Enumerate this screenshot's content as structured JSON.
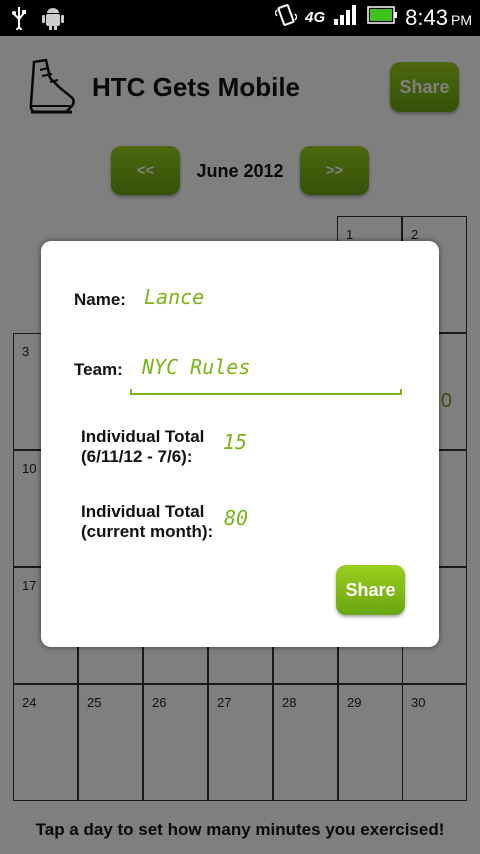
{
  "status_bar": {
    "network": "4G",
    "time": "8:43",
    "ampm": "PM"
  },
  "header": {
    "title": "HTC Gets Mobile",
    "share_label": "Share"
  },
  "month_nav": {
    "prev_label": "<<",
    "month": "June 2012",
    "next_label": ">>"
  },
  "calendar": {
    "cells": [
      {
        "day": "1"
      },
      {
        "day": "2"
      },
      {
        "day": "3"
      },
      {
        "day": "10"
      },
      {
        "day": "17"
      },
      {
        "day": "24"
      },
      {
        "day": "25"
      },
      {
        "day": "26"
      },
      {
        "day": "27"
      },
      {
        "day": "28"
      },
      {
        "day": "29"
      },
      {
        "day": "30"
      }
    ],
    "partial_value": "0"
  },
  "footer_hint": "Tap a day to set how many minutes you exercised!",
  "dialog": {
    "name_label": "Name:",
    "name_value": "Lance",
    "team_label": "Team:",
    "team_value": "NYC Rules",
    "individual_total_label_1": "Individual Total",
    "individual_total_range": "(6/11/12 - 7/6):",
    "individual_total_value": "15",
    "individual_month_label_1": "Individual Total",
    "individual_month_label_2": "(current month):",
    "individual_month_value": "80",
    "share_label": "Share"
  },
  "colors": {
    "accent": "#79b515",
    "button_top": "#9bcf1e",
    "button_bottom": "#6aa410"
  }
}
